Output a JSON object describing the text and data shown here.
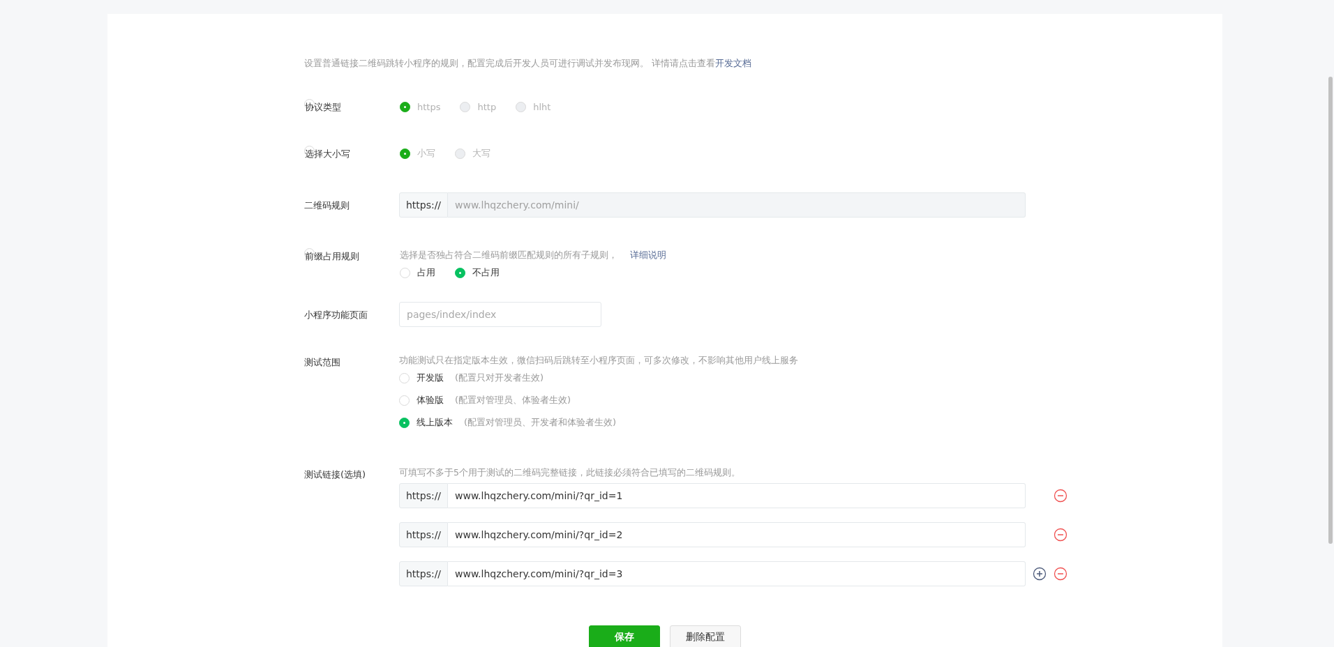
{
  "intro": {
    "text": "设置普通链接二维码跳转小程序的规则，配置完成后开发人员可进行调试并发布现网。 详情请点击查看",
    "link": "开发文档"
  },
  "fields": [
    {
      "kind": "radio",
      "label": "协议类型",
      "disabled": true,
      "options": [
        {
          "label": "https",
          "selected": true
        },
        {
          "label": "http",
          "selected": false
        },
        {
          "label": "hlht",
          "selected": false
        }
      ]
    },
    {
      "kind": "radio",
      "label": "选择大小写",
      "disabled": true,
      "options": [
        {
          "label": "小写",
          "selected": true
        },
        {
          "label": "大写",
          "selected": false
        }
      ]
    },
    {
      "kind": "prefixed-input",
      "label": "二维码规则",
      "prefix": "https://",
      "placeholder": "www.lhqzchery.com/mini/",
      "disabled": true
    },
    {
      "kind": "radio",
      "label": "前缀占用规则",
      "hint": "选择是否独占符合二维码前缀匹配规则的所有子规则，",
      "hint_link": "详细说明",
      "disabled": false,
      "options": [
        {
          "label": "占用",
          "selected": false
        },
        {
          "label": "不占用",
          "selected": true
        }
      ]
    },
    {
      "kind": "input",
      "label": "小程序功能页面",
      "placeholder": "pages/index/index"
    },
    {
      "kind": "radio-list",
      "label": "测试范围",
      "hint": "功能测试只在指定版本生效，微信扫码后跳转至小程序页面，可多次修改，不影响其他用户线上服务",
      "disabled": false,
      "options": [
        {
          "label": "开发版",
          "note": "(配置只对开发者生效)",
          "selected": false
        },
        {
          "label": "体验版",
          "note": "(配置对管理员、体验者生效)",
          "selected": false
        },
        {
          "label": "线上版本",
          "note": "(配置对管理员、开发者和体验者生效)",
          "selected": true
        }
      ]
    },
    {
      "kind": "link-list",
      "label": "测试链接(选填)",
      "hint": "可填写不多于5个用于测试的二维码完整链接，此链接必须符合已填写的二维码规则。",
      "items": [
        {
          "prefix": "https://",
          "value": "www.lhqzchery.com/mini/?qr_id=1"
        },
        {
          "prefix": "https://",
          "value": "www.lhqzchery.com/mini/?qr_id=2"
        },
        {
          "prefix": "https://",
          "value": "www.lhqzchery.com/mini/?qr_id=3"
        }
      ]
    }
  ],
  "buttons": [
    {
      "label": "保存",
      "kind": "primary"
    },
    {
      "label": "删除配置",
      "kind": "default"
    }
  ]
}
